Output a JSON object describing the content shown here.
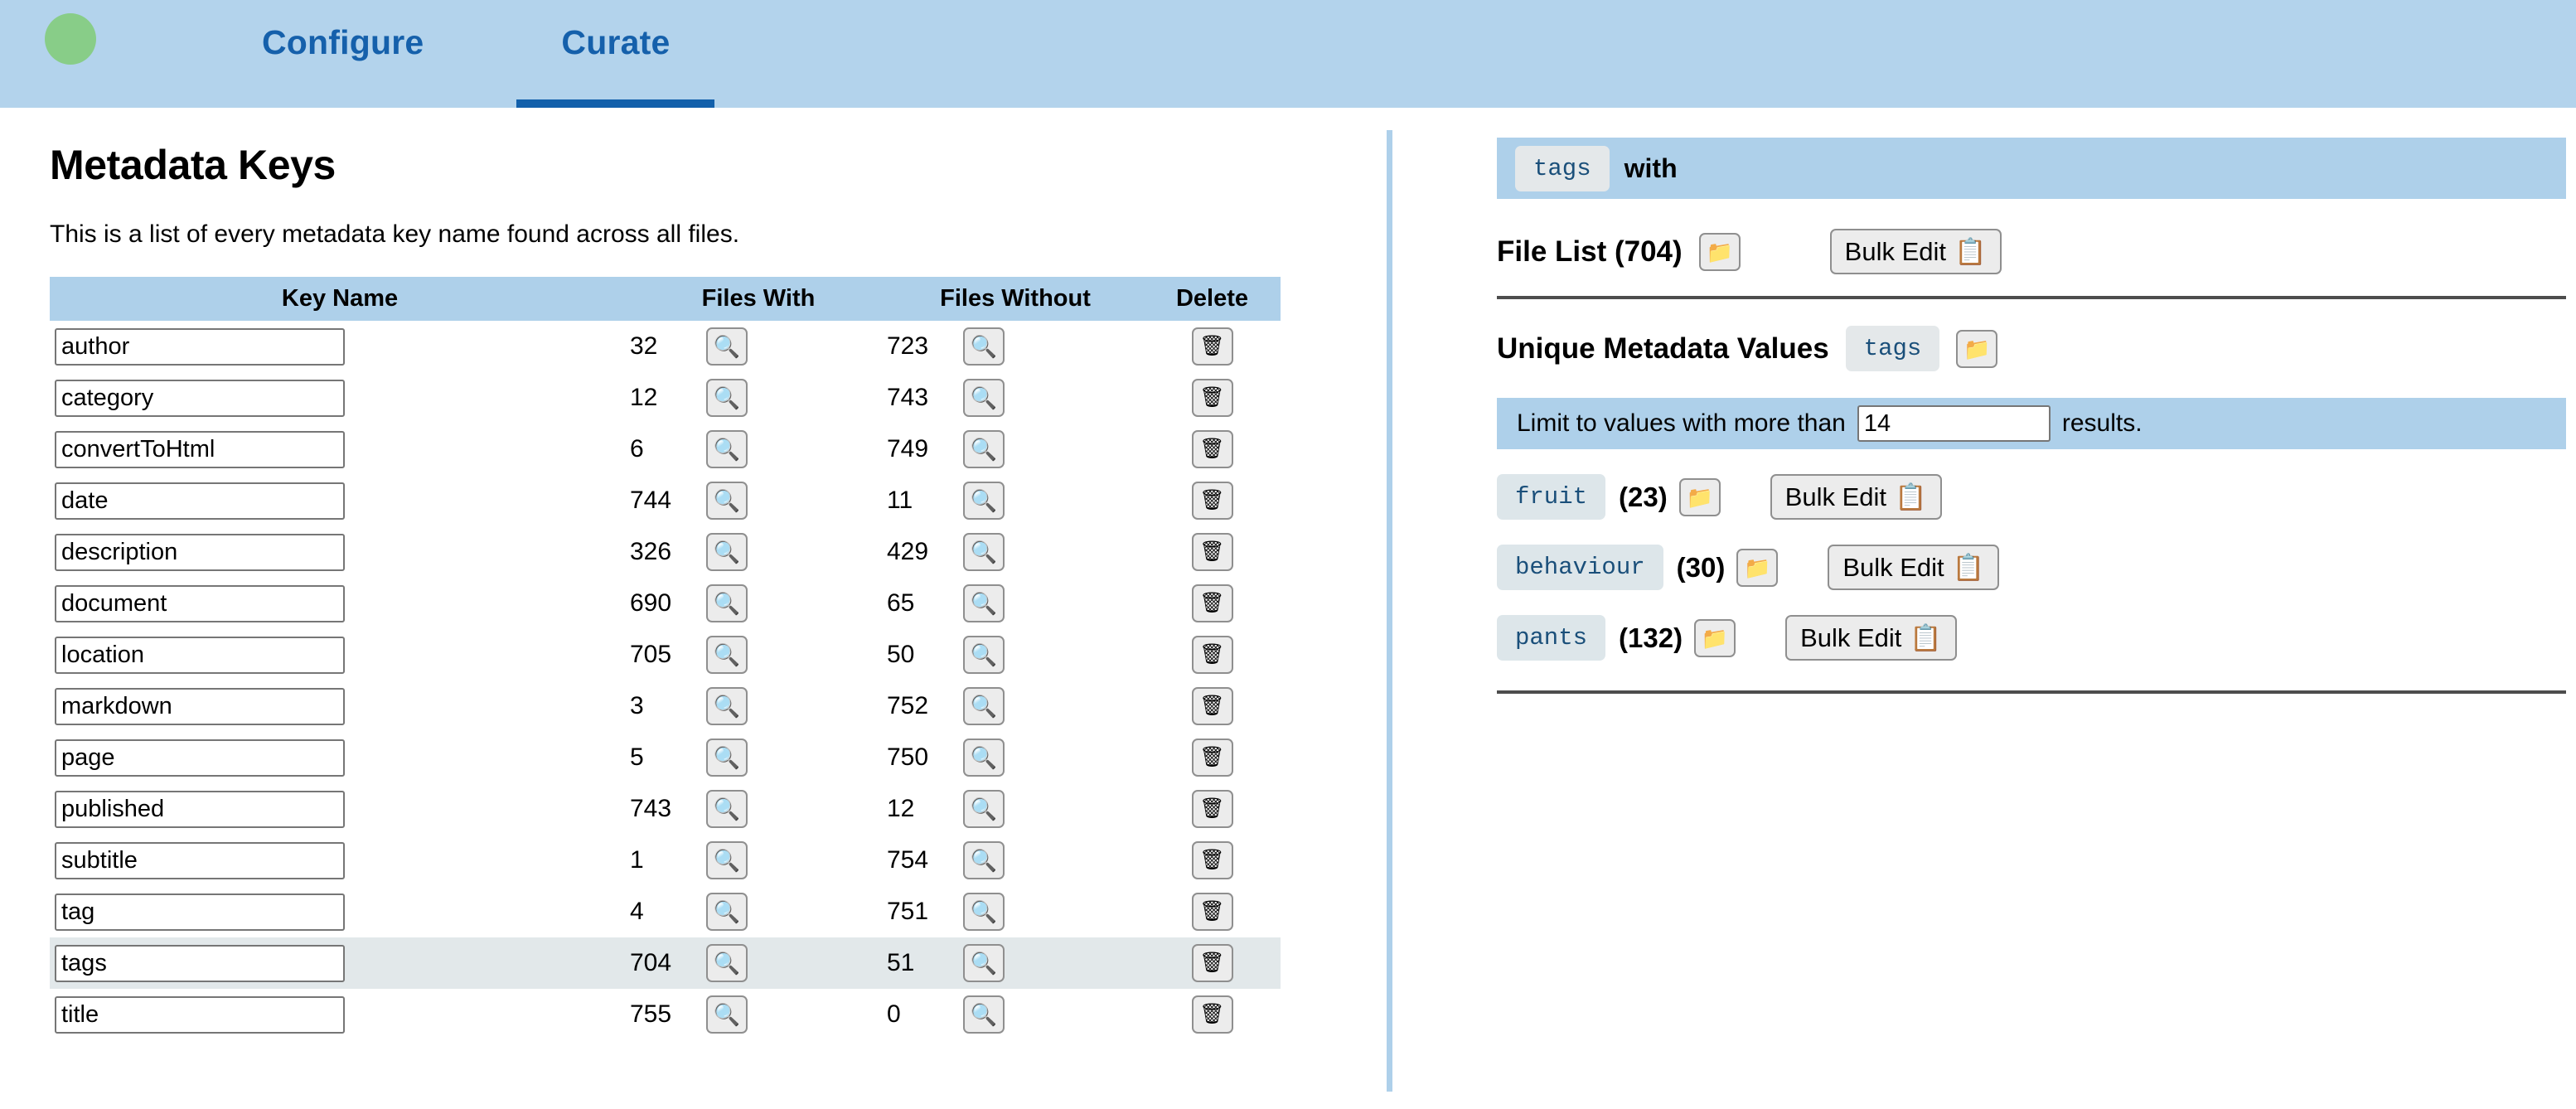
{
  "topbar": {
    "logo_icon": "green-circle-logo",
    "tabs": [
      {
        "label": "Configure",
        "active": false
      },
      {
        "label": "Curate",
        "active": true
      }
    ]
  },
  "left": {
    "title": "Metadata Keys",
    "subtitle": "This is a list of every metadata key name found across all files.",
    "table": {
      "headers": [
        "Key Name",
        "Files With",
        "Files Without",
        "Delete"
      ],
      "search_icon": "magnifying-glass-icon",
      "delete_icon": "wastebasket-icon",
      "rows": [
        {
          "key": "author",
          "with": "32",
          "without": "723",
          "selected": false
        },
        {
          "key": "category",
          "with": "12",
          "without": "743",
          "selected": false
        },
        {
          "key": "convertToHtml",
          "with": "6",
          "without": "749",
          "selected": false
        },
        {
          "key": "date",
          "with": "744",
          "without": "11",
          "selected": false
        },
        {
          "key": "description",
          "with": "326",
          "without": "429",
          "selected": false
        },
        {
          "key": "document",
          "with": "690",
          "without": "65",
          "selected": false
        },
        {
          "key": "location",
          "with": "705",
          "without": "50",
          "selected": false
        },
        {
          "key": "markdown",
          "with": "3",
          "without": "752",
          "selected": false
        },
        {
          "key": "page",
          "with": "5",
          "without": "750",
          "selected": false
        },
        {
          "key": "published",
          "with": "743",
          "without": "12",
          "selected": false
        },
        {
          "key": "subtitle",
          "with": "1",
          "without": "754",
          "selected": false
        },
        {
          "key": "tag",
          "with": "4",
          "without": "751",
          "selected": false
        },
        {
          "key": "tags",
          "with": "704",
          "without": "51",
          "selected": true
        },
        {
          "key": "title",
          "with": "755",
          "without": "0",
          "selected": false
        }
      ]
    }
  },
  "right": {
    "filter": {
      "chip": "tags",
      "text": "with"
    },
    "file_list": {
      "heading": "File List (704)",
      "folder_icon": "folder-icon",
      "bulk_edit_label": "Bulk Edit",
      "bulk_edit_icon": "clipboard-icon"
    },
    "unique_values": {
      "heading": "Unique Metadata Values",
      "chip": "tags",
      "folder_icon": "folder-icon",
      "limit": {
        "prefix": "Limit to values with more than",
        "value": "14",
        "suffix": "results."
      },
      "items": [
        {
          "value": "fruit",
          "count": "(23)",
          "folder_icon": "folder-icon",
          "bulk_edit_label": "Bulk Edit",
          "bulk_edit_icon": "clipboard-icon"
        },
        {
          "value": "behaviour",
          "count": "(30)",
          "folder_icon": "folder-icon",
          "bulk_edit_label": "Bulk Edit",
          "bulk_edit_icon": "clipboard-icon"
        },
        {
          "value": "pants",
          "count": "(132)",
          "folder_icon": "folder-icon",
          "bulk_edit_label": "Bulk Edit",
          "bulk_edit_icon": "clipboard-icon"
        }
      ]
    }
  },
  "colors": {
    "nav_background": "#b3d3ec",
    "accent_blue": "#1260ab",
    "band_blue": "#aed0ea",
    "logo_green": "#88cd88",
    "chip_background": "#e4e8ea",
    "selected_row": "#e2e8ea",
    "separator": "#4d4d4d"
  }
}
